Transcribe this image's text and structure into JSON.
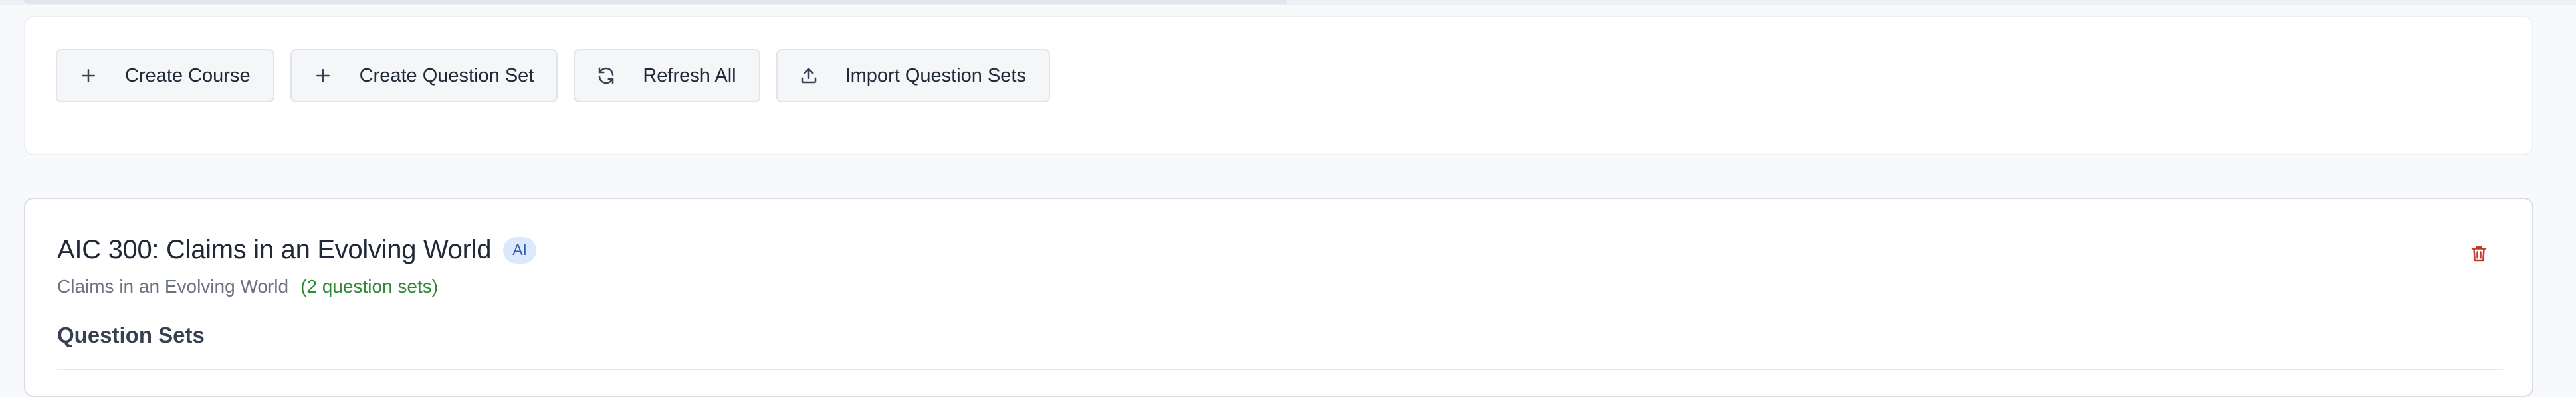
{
  "toolbar": {
    "buttons": [
      {
        "label": "Create Course",
        "icon": "plus-icon"
      },
      {
        "label": "Create Question Set",
        "icon": "plus-icon"
      },
      {
        "label": "Refresh All",
        "icon": "refresh-icon"
      },
      {
        "label": "Import Question Sets",
        "icon": "upload-icon"
      }
    ]
  },
  "course": {
    "title": "AIC 300: Claims in an Evolving World",
    "badge": "AI",
    "description": "Claims in an Evolving World",
    "question_count": "(2 question sets)",
    "delete_icon": "trash-icon",
    "section_heading": "Question Sets"
  },
  "colors": {
    "badge_bg": "#dde8fb",
    "badge_text": "#2f5fb4",
    "count_text": "#2e8b3a",
    "delete_icon": "#c0392b"
  }
}
